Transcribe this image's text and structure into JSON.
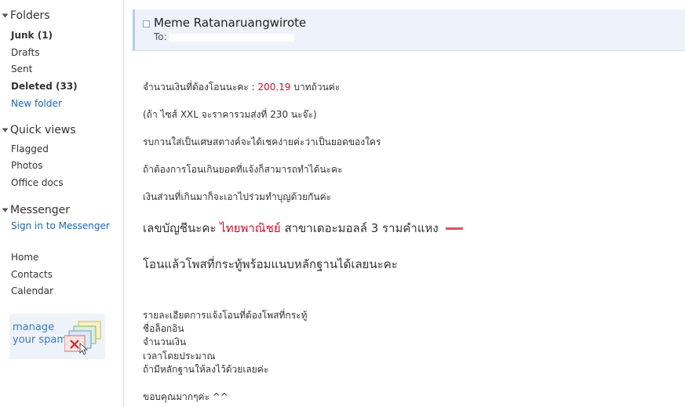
{
  "sidebar": {
    "folders": {
      "title": "Folders",
      "items": [
        {
          "label": "Junk (1)"
        },
        {
          "label": "Drafts"
        },
        {
          "label": "Sent"
        },
        {
          "label": "Deleted (33)"
        },
        {
          "label": "New folder"
        }
      ]
    },
    "quick_views": {
      "title": "Quick views",
      "items": [
        {
          "label": "Flagged"
        },
        {
          "label": "Photos"
        },
        {
          "label": "Office docs"
        }
      ]
    },
    "messenger": {
      "title": "Messenger",
      "sign_in": "Sign in to Messenger"
    },
    "links": [
      {
        "label": "Home"
      },
      {
        "label": "Contacts"
      },
      {
        "label": "Calendar"
      }
    ],
    "spam_ad": {
      "line1": "manage",
      "line2": "your spam"
    }
  },
  "message": {
    "sender": "Meme Ratanaruangwirote",
    "to_prefix": "To:",
    "body": {
      "amount_label": "จำนวนเงินที่ต้องโอนนะคะ  :",
      "amount_value": "200.19",
      "amount_suffix": "บาทถ้วนค่ะ",
      "line2": "(ถ้า ไซส์ XXL จะราคารวมส่งที่ 230 นะจ๊ะ)",
      "line3": "รบกวนใส่เป็นเศษสตางค์จะได้เชคง่ายค่ะว่าเป็นยอดของใคร",
      "line4": "ถ้าต้องการโอนเกินยอดที่แจ้งก็สามารถทำได้นะคะ",
      "line5": "เงินส่วนที่เกินมาก็จะเอาไปร่วมทำบุญด้วยกันค่ะ",
      "account_prefix": "เลขบัญชีนะคะ",
      "bank": "ไทยพาณิชย์",
      "branch": "สาขาเดอะมอลล์ 3 รามคำแหง",
      "transfer_note": "โอนแล้วโพสที่กระทู้พร้อมแนบหลักฐานได้เลยนะคะ",
      "details_title": "รายละเอียดการแจ้งโอนที่ต้องโพสที่กระทู้",
      "detail_1": "ชื่อล็อกอิน",
      "detail_2": "จำนวนเงิน",
      "detail_3": "เวลาโดยประมาณ",
      "detail_4": "ถ้ามีหลักฐานให้ลงไว้ด้วยเลยค่ะ",
      "closing": "ขอบคุณมากๆค่ะ ^^"
    }
  },
  "colors": {
    "link": "#1a66b8",
    "amount": "#d0102a",
    "header_bg": "#eef3fb"
  }
}
